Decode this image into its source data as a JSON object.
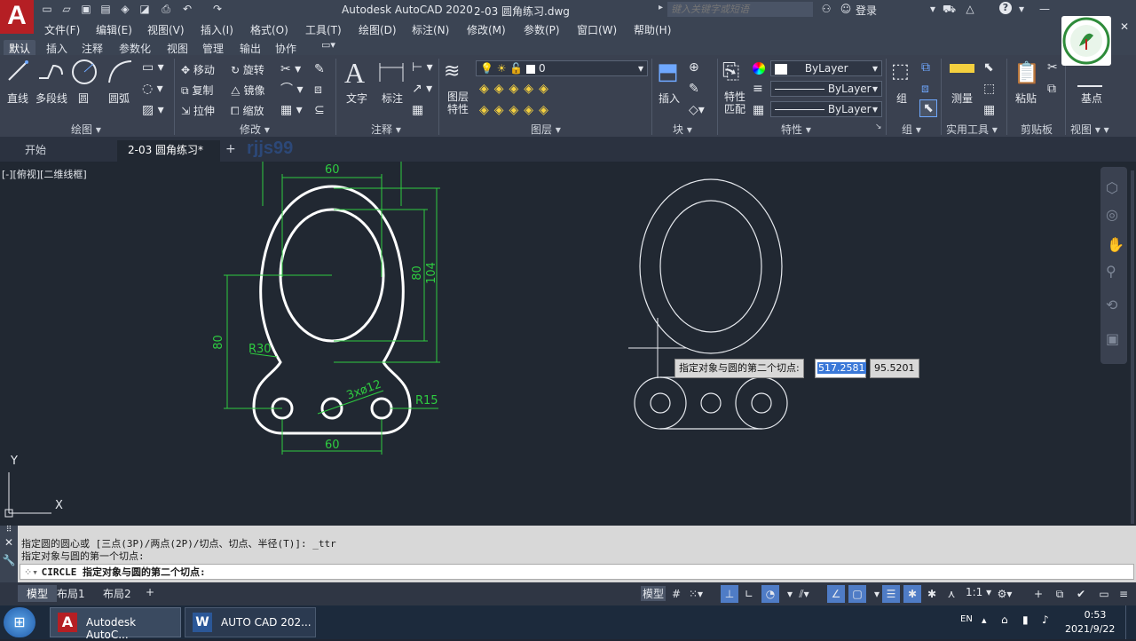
{
  "title_bar": {
    "app_title": "Autodesk AutoCAD 2020",
    "file_title": "2-03 圆角练习.dwg",
    "search_placeholder": "键入关键字或短语",
    "login": "登录",
    "help": "?"
  },
  "menu": [
    "文件(F)",
    "编辑(E)",
    "视图(V)",
    "插入(I)",
    "格式(O)",
    "工具(T)",
    "绘图(D)",
    "标注(N)",
    "修改(M)",
    "参数(P)",
    "窗口(W)",
    "帮助(H)"
  ],
  "ribbon_tabs": [
    "默认",
    "插入",
    "注释",
    "参数化",
    "视图",
    "管理",
    "输出",
    "协作"
  ],
  "ribbon": {
    "draw": {
      "title": "绘图",
      "line": "直线",
      "polyline": "多段线",
      "circle": "圆",
      "arc": "圆弧"
    },
    "modify": {
      "title": "修改",
      "move": "移动",
      "rotate": "旋转",
      "copy": "复制",
      "mirror": "镜像",
      "stretch": "拉伸",
      "scale": "缩放"
    },
    "annotation": {
      "title": "注释",
      "text": "文字",
      "dimension": "标注"
    },
    "layers": {
      "title": "图层",
      "layer_props": "图层\n特性",
      "current_layer": "0"
    },
    "block": {
      "title": "块",
      "insert": "插入"
    },
    "properties": {
      "title": "特性",
      "match": "特性\n匹配",
      "color": "ByLayer",
      "linetype": "ByLayer",
      "lineweight": "ByLayer"
    },
    "groups": {
      "title": "组",
      "group": "组"
    },
    "utilities": {
      "title": "实用工具",
      "measure": "测量"
    },
    "clipboard": {
      "title": "剪贴板",
      "paste": "粘贴"
    },
    "view": {
      "title": "视图",
      "base": "基点"
    }
  },
  "file_tabs": {
    "start": "开始",
    "current": "2-03 圆角练习*",
    "close": "×",
    "plus": "+"
  },
  "watermark": "rjjs99",
  "viewport_label": "[-][俯视][二维线框]",
  "drawing": {
    "dim_top": "60",
    "dim_bottom": "60",
    "dim_80_right": "80",
    "dim_104": "104",
    "dim_80_left": "80",
    "r30": "R30",
    "holes": "3xø12",
    "r15": "R15"
  },
  "tooltip": {
    "prompt": "指定对象与圆的第二个切点:",
    "x": "517.2581",
    "y": "95.5201"
  },
  "ucs": {
    "x": "X",
    "y": "Y"
  },
  "command": {
    "line1": "指定圆的圆心或 [三点(3P)/两点(2P)/切点、切点、半径(T)]: _ttr",
    "line2": "指定对象与圆的第一个切点:",
    "prompt": "CIRCLE 指定对象与圆的第二个切点:",
    "cmd_name": "CIRCLE"
  },
  "layout_tabs": [
    "模型",
    "布局1",
    "布局2"
  ],
  "status": {
    "model": "模型",
    "scale": "1:1"
  },
  "taskbar": {
    "app1": "Autodesk AutoC...",
    "app2": "AUTO CAD 202...",
    "lang": "EN",
    "time": "0:53",
    "date": "2021/9/22"
  },
  "colors": {
    "accent": "#4f7cc6",
    "drawing_green": "#2ecc40",
    "drawing_white": "#ffffff",
    "canvas": "#212832"
  }
}
